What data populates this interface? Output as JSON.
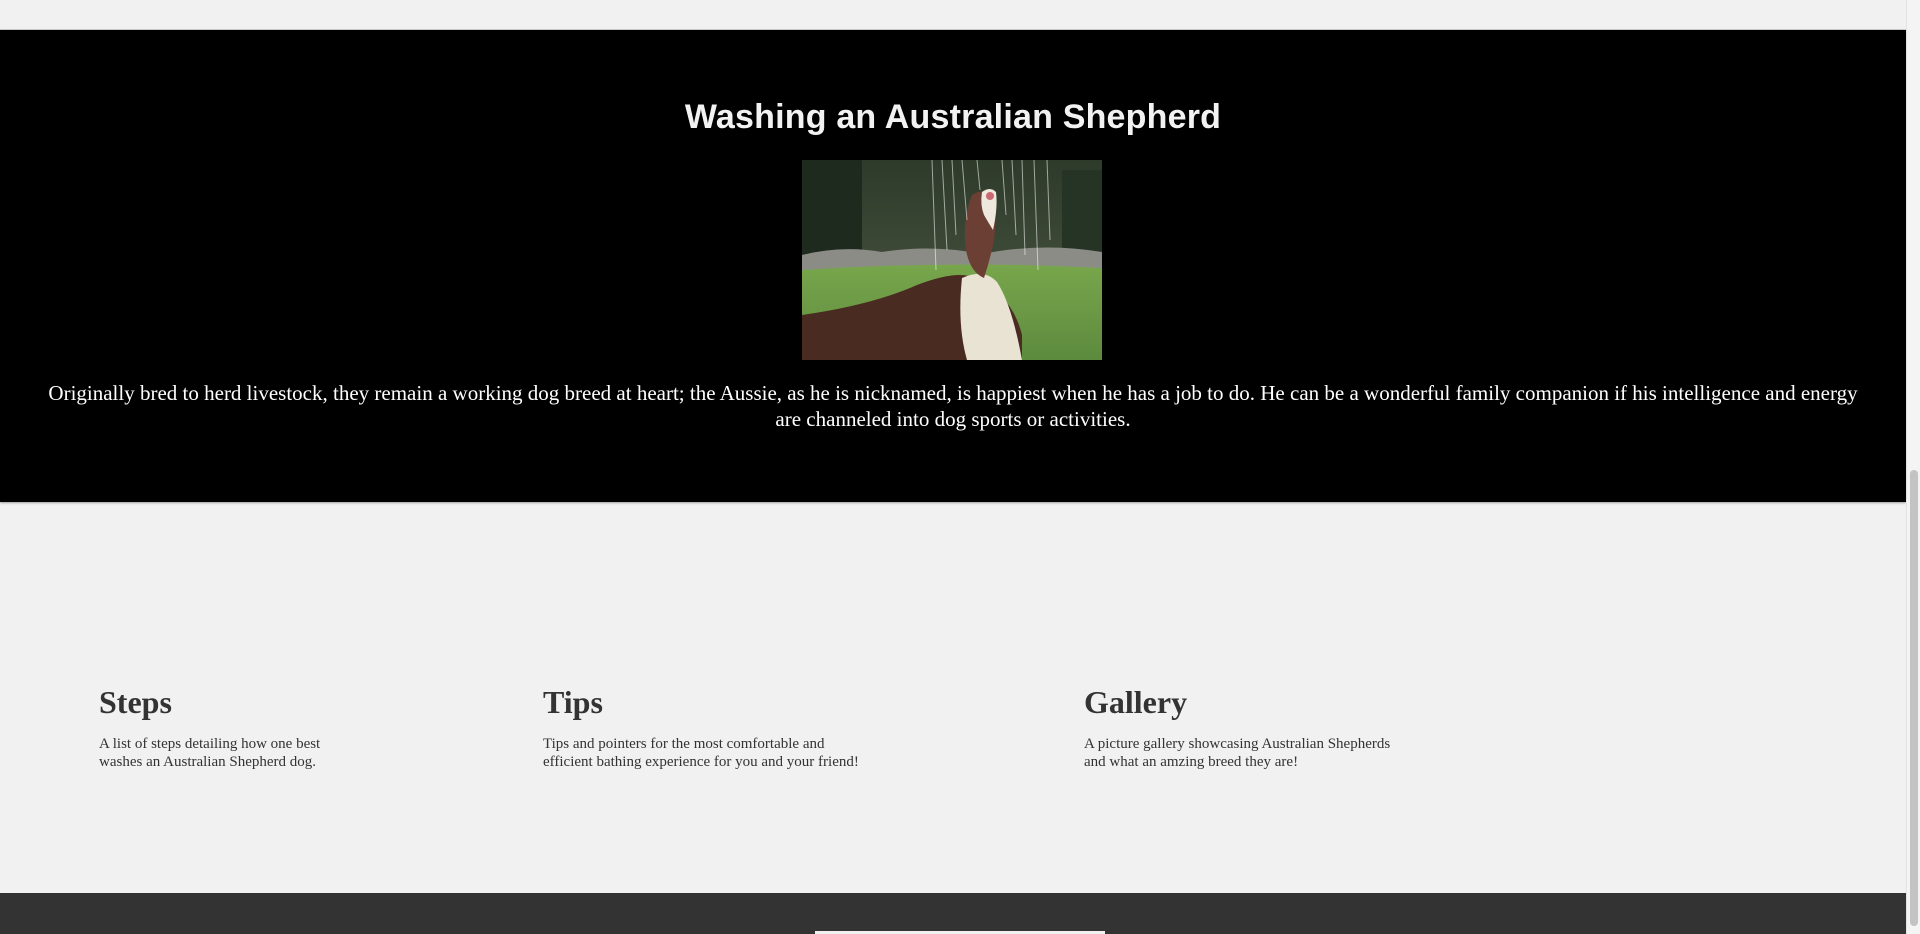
{
  "hero": {
    "title": "Washing an Australian Shepherd",
    "image_alt": "Australian Shepherd under water sprinkler",
    "description": "Originally bred to herd livestock, they remain a working dog breed at heart; the Aussie, as he is nicknamed, is happiest when he has a job to do. He can be a wonderful family companion if his intelligence and energy are channeled into dog sports or activities."
  },
  "sections": [
    {
      "title": "Steps",
      "lines": [
        "A list of steps detailing how one best",
        "washes an Australian Shepherd dog."
      ]
    },
    {
      "title": "Tips",
      "lines": [
        "Tips and pointers for the most comfortable and",
        "efficient bathing experience for you and your friend!"
      ]
    },
    {
      "title": "Gallery",
      "lines": [
        "A picture gallery showcasing Australian Shepherds",
        "and what an amzing breed they are!"
      ]
    }
  ],
  "colors": {
    "hero_background": "#000000",
    "page_background": "#f1f1f1",
    "footer_background": "#333333",
    "text_dark": "#333333"
  }
}
